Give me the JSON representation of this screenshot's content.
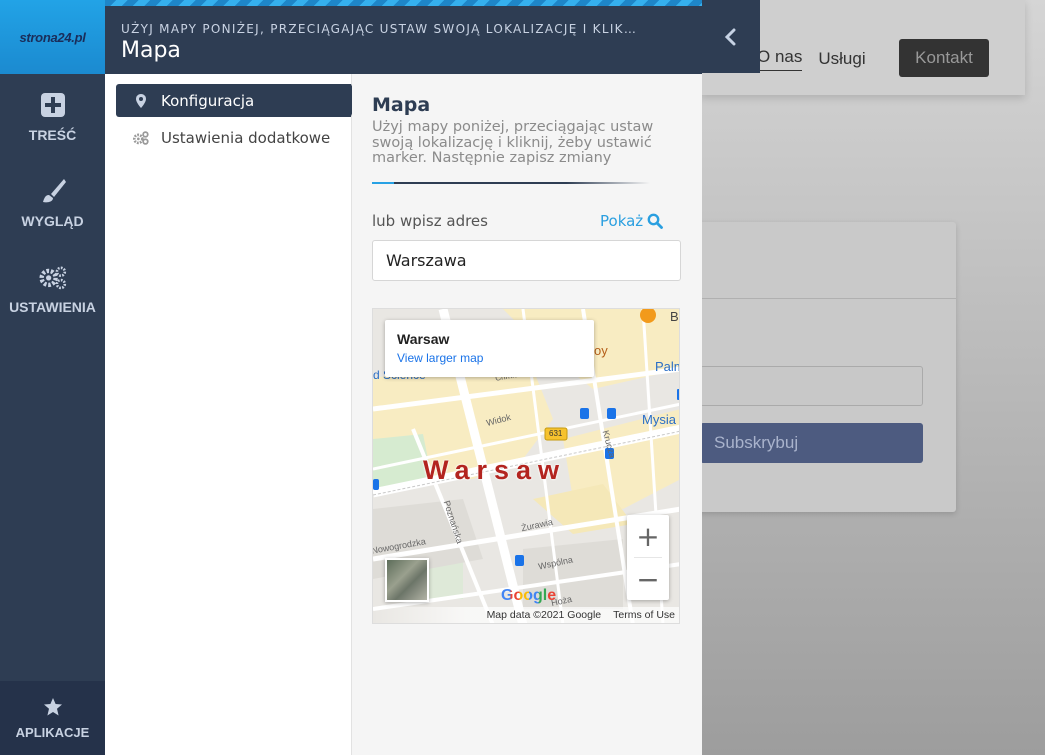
{
  "app": {
    "logo_text": "strona24.pl",
    "rail": [
      {
        "label": "TREŚĆ",
        "icon": "plus-square-icon"
      },
      {
        "label": "WYGLĄD",
        "icon": "brush-icon"
      },
      {
        "label": "USTAWIENIA",
        "icon": "gears-icon"
      }
    ],
    "rail_bottom": {
      "label": "APLIKACJE",
      "icon": "star-icon"
    }
  },
  "background_site": {
    "nav": [
      "O nas",
      "Usługi"
    ],
    "contact_label": "Kontakt",
    "subscribe_label": "Subskrybuj"
  },
  "modal": {
    "subtitle": "UŻYJ MAPY PONIŻEJ, PRZECIĄGAJĄC USTAW SWOJĄ LOKALIZACJĘ I KLIK…",
    "title": "Mapa",
    "collapse_icon": "chevron-left-icon",
    "nav": [
      {
        "label": "Konfiguracja",
        "icon": "map-pin-icon",
        "active": true
      },
      {
        "label": "Ustawienia dodatkowe",
        "icon": "gears-icon",
        "active": false
      }
    ]
  },
  "content": {
    "title": "Mapa",
    "description": "Użyj mapy poniżej, przeciągając ustaw swoją lokalizację i kliknij, żeby ustawić marker. Następnie zapisz zmiany",
    "address_label": "lub wpisz adres",
    "show_label": "Pokaż",
    "address_value": "Warszawa"
  },
  "map": {
    "info_city": "Warsaw",
    "info_link": "View larger map",
    "city_label": "Warsaw",
    "street_labels": [
      "Widok",
      "Krucza",
      "Żurawia",
      "Wspólna",
      "Hoża",
      "Poznańska",
      "Chmielna",
      "Nowogrodzka"
    ],
    "poi_labels": [
      "Bu",
      "Palm",
      "Mysia",
      "oy",
      "d Science"
    ],
    "road_number": "631",
    "google_logo": "Google",
    "attribution": "Map data ©2021 Google",
    "terms": "Terms of Use",
    "zoom_in": "+",
    "zoom_out": "−"
  },
  "colors": {
    "sidebar": "#2e3d53",
    "accent": "#2a9fe0",
    "map_label": "#b3241f"
  }
}
